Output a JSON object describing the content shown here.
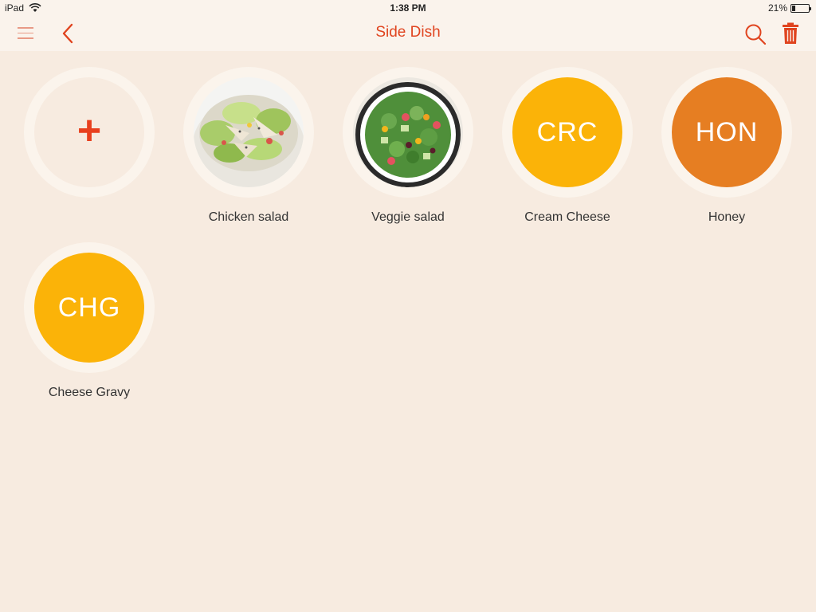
{
  "status": {
    "device": "iPad",
    "time": "1:38 PM",
    "battery_text": "21%",
    "battery_level": 0.21
  },
  "nav": {
    "title": "Side Dish",
    "icons": [
      "menu-icon",
      "back-chevron-icon",
      "search-icon",
      "trash-icon"
    ],
    "accent_color": "#e0441f"
  },
  "items": [
    {
      "label": "",
      "type": "add",
      "symbol": "+"
    },
    {
      "label": "Chicken salad",
      "type": "photo"
    },
    {
      "label": "Veggie salad",
      "type": "photo"
    },
    {
      "label": "Cream Cheese",
      "type": "abbr",
      "abbr": "CRC",
      "color": "#fbb308"
    },
    {
      "label": "Honey",
      "type": "abbr",
      "abbr": "HON",
      "color": "#e67e22"
    },
    {
      "label": "Cheese Gravy",
      "type": "abbr",
      "abbr": "CHG",
      "color": "#fbb308"
    }
  ]
}
